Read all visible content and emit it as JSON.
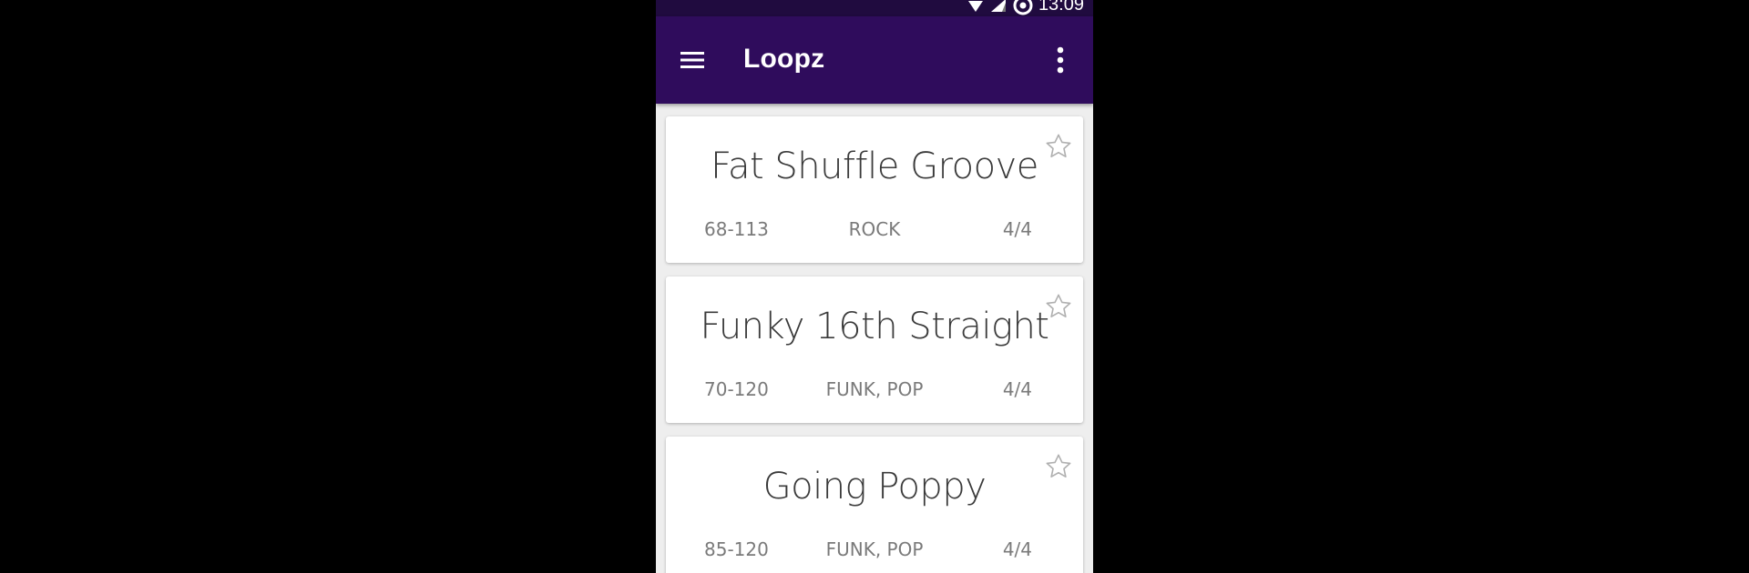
{
  "status_bar": {
    "time": "13:09"
  },
  "app_bar": {
    "title": "Loopz",
    "menu_icon": "hamburger-menu-icon",
    "overflow_icon": "more-vert-icon"
  },
  "colors": {
    "status_bar_bg": "#200b3f",
    "app_bar_bg": "#2f0c5c",
    "list_bg": "#eeeeee",
    "card_bg": "#ffffff",
    "title_text": "#3a3a3a",
    "meta_text": "#7a7a7a",
    "star_outline": "#b0b0b0"
  },
  "loops": [
    {
      "title": "Fat Shuffle Groove",
      "tempo": "68-113",
      "genre": "ROCK",
      "time_signature": "4/4",
      "favorite": false
    },
    {
      "title": "Funky 16th Straight",
      "tempo": "70-120",
      "genre": "FUNK, POP",
      "time_signature": "4/4",
      "favorite": false
    },
    {
      "title": "Going Poppy",
      "tempo": "85-120",
      "genre": "FUNK, POP",
      "time_signature": "4/4",
      "favorite": false
    }
  ]
}
